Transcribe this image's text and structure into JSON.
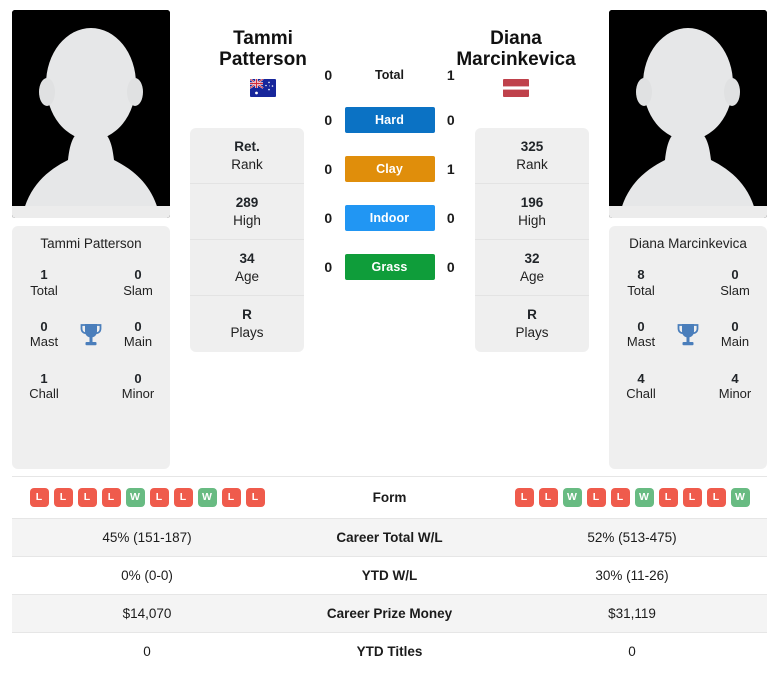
{
  "players": {
    "left": {
      "first_name": "Tammi",
      "last_name": "Patterson",
      "full_name": "Tammi Patterson",
      "flag_country": "Australia",
      "flag_icon": "australia-flag-icon",
      "avatar_icon": "player-avatar-placeholder-icon",
      "stats": [
        {
          "value": "Ret.",
          "label": "Rank"
        },
        {
          "value": "289",
          "label": "High"
        },
        {
          "value": "34",
          "label": "Age"
        },
        {
          "value": "R",
          "label": "Plays"
        }
      ],
      "titles": {
        "total": "1",
        "total_label": "Total",
        "slam": "0",
        "slam_label": "Slam",
        "mast": "0",
        "mast_label": "Mast",
        "main": "0",
        "main_label": "Main",
        "chall": "1",
        "chall_label": "Chall",
        "minor": "0",
        "minor_label": "Minor"
      },
      "form": [
        "L",
        "L",
        "L",
        "L",
        "W",
        "L",
        "L",
        "W",
        "L",
        "L"
      ],
      "career_total_wl": "45% (151-187)",
      "ytd_wl": "0% (0-0)",
      "career_prize_money": "$14,070",
      "ytd_titles": "0"
    },
    "right": {
      "first_name": "Diana",
      "last_name": "Marcinkevica",
      "full_name": "Diana Marcinkevica",
      "flag_country": "Latvia",
      "flag_icon": "latvia-flag-icon",
      "avatar_icon": "player-avatar-placeholder-icon",
      "stats": [
        {
          "value": "325",
          "label": "Rank"
        },
        {
          "value": "196",
          "label": "High"
        },
        {
          "value": "32",
          "label": "Age"
        },
        {
          "value": "R",
          "label": "Plays"
        }
      ],
      "titles": {
        "total": "8",
        "total_label": "Total",
        "slam": "0",
        "slam_label": "Slam",
        "mast": "0",
        "mast_label": "Mast",
        "main": "0",
        "main_label": "Main",
        "chall": "4",
        "chall_label": "Chall",
        "minor": "4",
        "minor_label": "Minor"
      },
      "form": [
        "L",
        "L",
        "W",
        "L",
        "L",
        "W",
        "L",
        "L",
        "L",
        "W"
      ],
      "career_total_wl": "52% (513-475)",
      "ytd_wl": "30% (11-26)",
      "career_prize_money": "$31,119",
      "ytd_titles": "0"
    }
  },
  "head_to_head": [
    {
      "label": "Total",
      "left": "0",
      "right": "1",
      "type": "total",
      "color": ""
    },
    {
      "label": "Hard",
      "left": "0",
      "right": "0",
      "type": "surface",
      "color": "#0b72c4"
    },
    {
      "label": "Clay",
      "left": "0",
      "right": "1",
      "type": "surface",
      "color": "#e08e0b"
    },
    {
      "label": "Indoor",
      "left": "0",
      "right": "0",
      "type": "surface",
      "color": "#2196f3"
    },
    {
      "label": "Grass",
      "left": "0",
      "right": "0",
      "type": "surface",
      "color": "#0f9d3a"
    }
  ],
  "comparison_rows": [
    {
      "label": "Form",
      "key": "form",
      "shade": false,
      "is_form": true
    },
    {
      "label": "Career Total W/L",
      "key": "career_total_wl",
      "shade": true,
      "is_form": false
    },
    {
      "label": "YTD W/L",
      "key": "ytd_wl",
      "shade": false,
      "is_form": false
    },
    {
      "label": "Career Prize Money",
      "key": "career_prize_money",
      "shade": true,
      "is_form": false
    },
    {
      "label": "YTD Titles",
      "key": "ytd_titles",
      "shade": false,
      "is_form": false
    }
  ],
  "icons": {
    "trophy": "trophy-icon"
  },
  "colors": {
    "win": "#68bb82",
    "loss": "#ef5b4c",
    "card_bg": "#efefef",
    "row_shade": "#f4f4f4"
  }
}
